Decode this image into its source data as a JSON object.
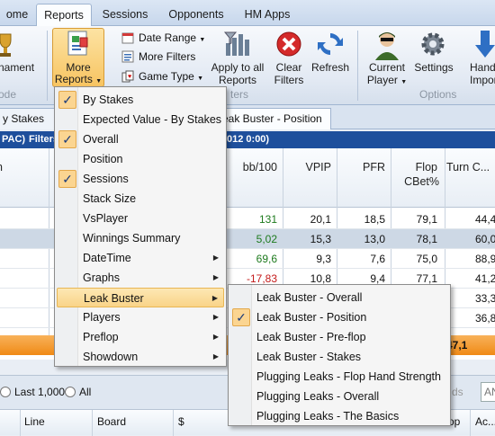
{
  "tabs": [
    "ome",
    "Reports",
    "Sessions",
    "Opponents",
    "HM Apps"
  ],
  "ribbon": {
    "tournament_label": "nament",
    "mode_group": "ode",
    "more_reports_line1": "More",
    "more_reports_line2": "Reports",
    "date_range": "Date Range",
    "more_filters": "More Filters",
    "game_type": "Game Type",
    "apply_line1": "Apply to all",
    "apply_line2": "Reports",
    "filters_group": "ters",
    "clear_line1": "Clear",
    "clear_line2": "Filters",
    "refresh": "Refresh",
    "current_line1": "Current",
    "current_line2": "Player",
    "settings": "Settings",
    "hand_line1": "Hand",
    "hand_line2": "Importin",
    "options_group": "Options"
  },
  "doc_tabs": {
    "left": "y Stakes",
    "right": "eak Buster - Position"
  },
  "filter_bar": {
    "left": "PAC)",
    "filters": "Filters",
    "right": "012 0:00)"
  },
  "columns": [
    "bb/100",
    "VPIP",
    "PFR",
    "Flop",
    "CBet%",
    "Turn C..."
  ],
  "rows": [
    {
      "bb": "131",
      "vpip": "20,1",
      "pfr": "18,5",
      "cbet": "79,1",
      "turn": "44,4",
      "color": "#1d7a1d"
    },
    {
      "bb": "5,02",
      "vpip": "15,3",
      "pfr": "13,0",
      "cbet": "78,1",
      "turn": "60,0",
      "color": "#1d7a1d"
    },
    {
      "bb": "69,6",
      "vpip": "9,3",
      "pfr": "7,6",
      "cbet": "75,0",
      "turn": "88,9",
      "color": "#1d7a1d"
    },
    {
      "bb": "-17,83",
      "vpip": "10,8",
      "pfr": "9,4",
      "cbet": "77,1",
      "turn": "41,2",
      "color": "#c41a1a"
    },
    {
      "bb": "",
      "vpip": "",
      "pfr": "",
      "cbet": "",
      "turn": "33,3",
      "color": "#111"
    },
    {
      "bb": "",
      "vpip": "",
      "pfr": "",
      "cbet": "",
      "turn": "36,8",
      "color": "#111"
    }
  ],
  "total_turn": "47,1",
  "bottom": {
    "last": "Last 1,000",
    "all": "All",
    "hands": "ds",
    "search_placeholder": "AN",
    "cols": [
      "Line",
      "Board",
      "$",
      "op",
      "Ac..."
    ]
  },
  "menu_main": [
    {
      "label": "By Stakes",
      "checked": true
    },
    {
      "label": "Expected Value - By Stakes",
      "checked": false
    },
    {
      "label": "Overall",
      "checked": true
    },
    {
      "label": "Position",
      "checked": false
    },
    {
      "label": "Sessions",
      "checked": true
    },
    {
      "label": "Stack Size",
      "checked": false
    },
    {
      "label": "VsPlayer",
      "checked": false
    },
    {
      "label": "Winnings Summary",
      "checked": false
    },
    {
      "label": "DateTime",
      "checked": false,
      "sub": true
    },
    {
      "label": "Graphs",
      "checked": false,
      "sub": true
    },
    {
      "label": "Leak Buster",
      "checked": false,
      "sub": true,
      "highlight": true
    },
    {
      "label": "Players",
      "checked": false,
      "sub": true
    },
    {
      "label": "Preflop",
      "checked": false,
      "sub": true
    },
    {
      "label": "Showdown",
      "checked": false,
      "sub": true
    }
  ],
  "menu_sub": [
    {
      "label": "Leak Buster - Overall",
      "checked": false
    },
    {
      "label": "Leak Buster - Position",
      "checked": true
    },
    {
      "label": "Leak Buster - Pre-flop",
      "checked": false
    },
    {
      "label": "Leak Buster - Stakes",
      "checked": false
    },
    {
      "label": "Plugging Leaks - Flop Hand Strength",
      "checked": false
    },
    {
      "label": "Plugging Leaks - Overall",
      "checked": false
    },
    {
      "label": "Plugging Leaks - The Basics",
      "checked": false
    }
  ],
  "icons": {
    "check": "✓",
    "submenu_arrow": "▶"
  }
}
